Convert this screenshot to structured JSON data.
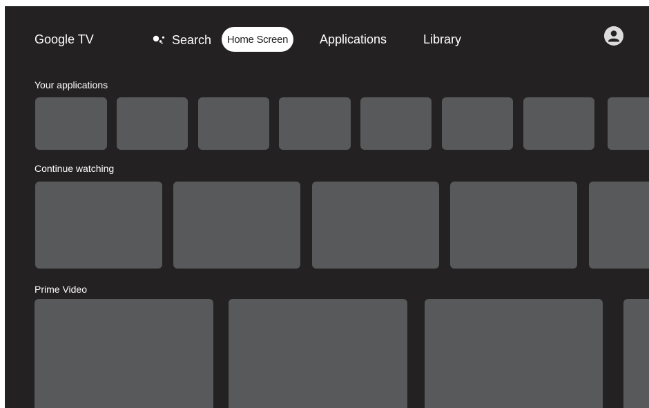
{
  "header": {
    "brand": "Google TV",
    "search_label": "Search",
    "tabs": [
      {
        "label": "Home Screen",
        "selected": true
      },
      {
        "label": "Applications",
        "selected": false
      },
      {
        "label": "Library",
        "selected": false
      }
    ],
    "profile_icon": "account-circle-icon",
    "search_icon": "google-assistant-icon"
  },
  "rows": [
    {
      "title": "Your applications",
      "tile_count": 8
    },
    {
      "title": "Continue watching",
      "tile_count": 5
    },
    {
      "title": "Prime Video",
      "tile_count": 4
    }
  ],
  "colors": {
    "background": "#232122",
    "tile": "#58595a",
    "selected_tab_bg": "#ffffff",
    "text": "#ffffff"
  }
}
